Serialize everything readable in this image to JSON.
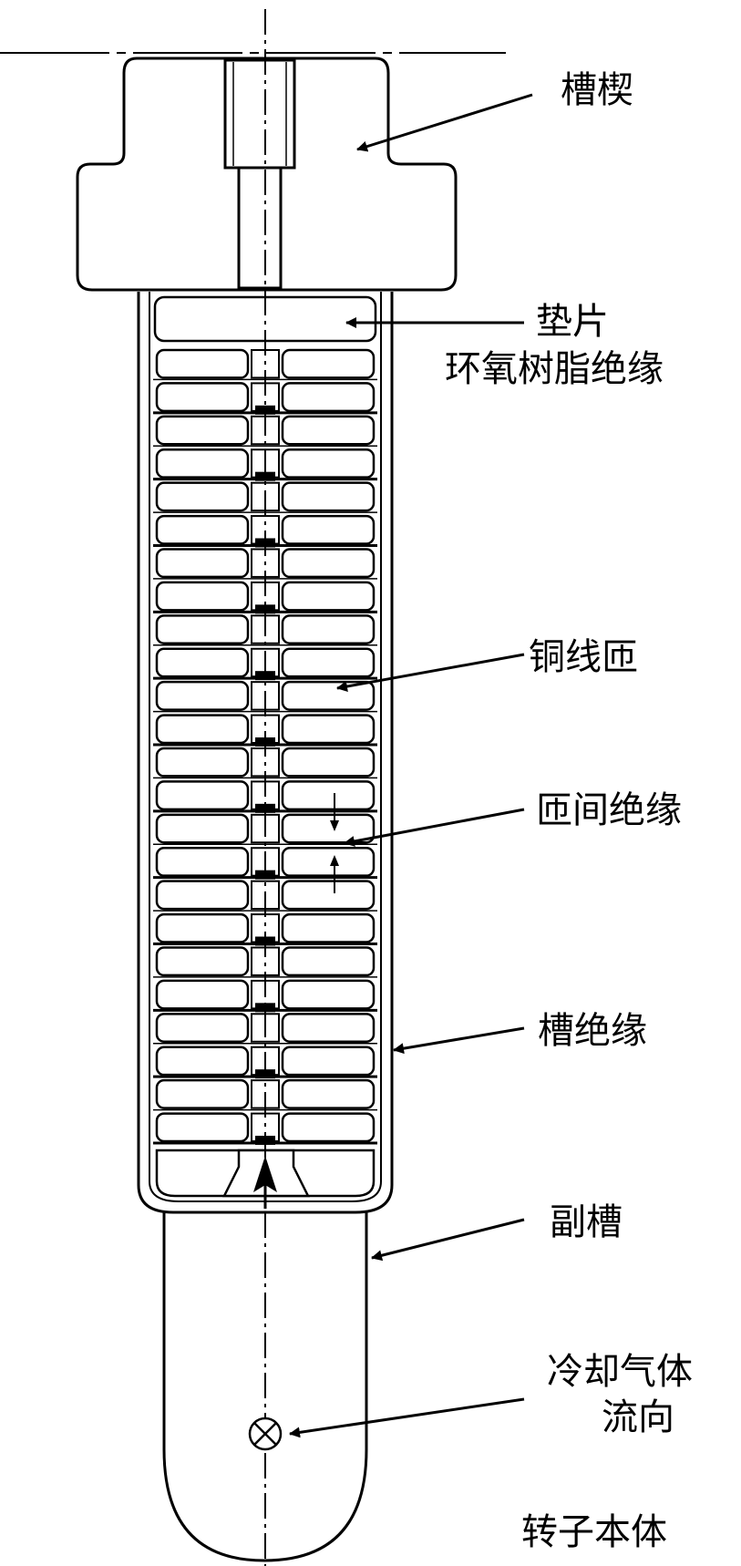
{
  "labels": {
    "wedge": "槽楔",
    "spacer": "垫片",
    "epoxy": "环氧树脂绝缘",
    "copper_turn": "铜线匝",
    "turn_insulation": "匝间绝缘",
    "slot_insulation": "槽绝缘",
    "sub_slot": "副槽",
    "gas_flow_1": "冷却气体",
    "gas_flow_2": "流向",
    "rotor_body": "转子本体"
  },
  "colors": {
    "ink": "#000000",
    "paper": "#ffffff"
  },
  "symbols": {
    "flow_into_page": "circle-cross-icon",
    "flow_up": "arrow-up-icon"
  }
}
